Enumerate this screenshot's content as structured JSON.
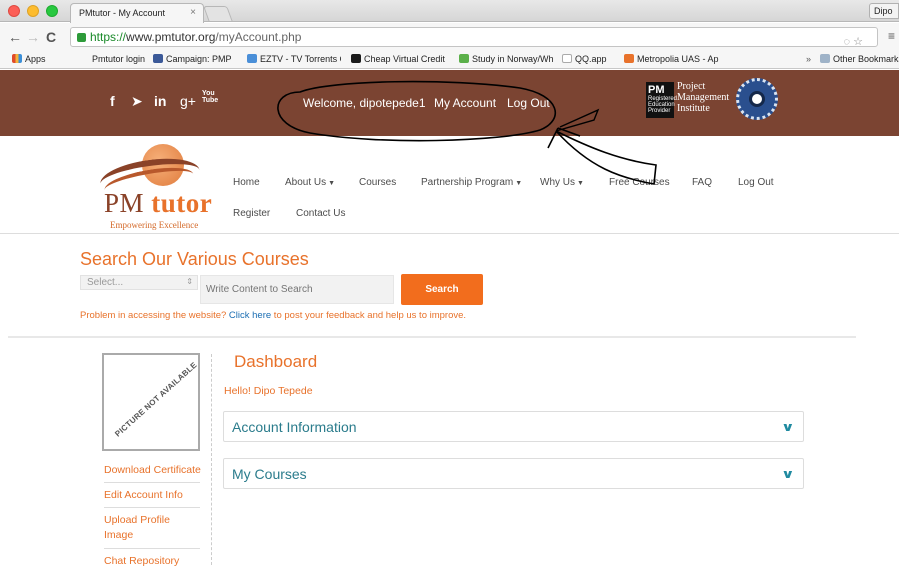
{
  "browser": {
    "tab_title": "PMtutor - My Account",
    "tab_close": "×",
    "profile": "Dipo",
    "url_scheme": "https://",
    "url_host": "www.pmtutor.org",
    "url_path": "/myAccount.php",
    "bookmarks": [
      {
        "label": "Apps",
        "color": "#e04b2a"
      },
      {
        "label": "Pmtutor login",
        "color": ""
      },
      {
        "label": "Campaign: PMP",
        "color": "#3b5998"
      },
      {
        "label": "EZTV - TV Torrents Online",
        "color": "#4a8fd8"
      },
      {
        "label": "Cheap Virtual Credit",
        "color": "#1b1b1b"
      },
      {
        "label": "Study in Norway/What",
        "color": "#5bb04a"
      },
      {
        "label": "QQ.app",
        "color": "#cccccc"
      },
      {
        "label": "Metropolia UAS - Ap",
        "color": "#e8722b"
      },
      {
        "label": "Other Bookmarks",
        "color": "#9fb3c8"
      }
    ],
    "bookmarks_more": "»"
  },
  "banner": {
    "welcome": "Welcome, dipotepede1",
    "my_account": "My Account",
    "logout": "Log Out",
    "pmi_small": "Registered Education Provider",
    "pmi_lines": [
      "Project",
      "Management",
      "Institute"
    ],
    "social": [
      "f",
      "t",
      "in",
      "g+",
      "You Tube"
    ]
  },
  "site": {
    "logo_pm": "PM",
    "logo_tutor": "tutor",
    "logo_tagline": "Empowering Excellence",
    "menu": [
      {
        "label": "Home",
        "caret": ""
      },
      {
        "label": "About Us",
        "caret": "▼"
      },
      {
        "label": "Courses",
        "caret": ""
      },
      {
        "label": "Partnership Program",
        "caret": "▼"
      },
      {
        "label": "Why Us",
        "caret": "▼"
      },
      {
        "label": "Free Courses",
        "caret": ""
      },
      {
        "label": "FAQ",
        "caret": ""
      },
      {
        "label": "Log Out",
        "caret": ""
      },
      {
        "label": "Register",
        "caret": ""
      },
      {
        "label": "Contact Us",
        "caret": ""
      }
    ]
  },
  "search": {
    "title": "Search Our Various Courses",
    "select_value": "Select...",
    "input_placeholder": "Write Content to Search",
    "button": "Search",
    "problem_prefix": "Problem in accessing the website? ",
    "problem_link": "Click here",
    "problem_suffix": " to post your feedback and help us to improve."
  },
  "dashboard": {
    "picture_text": "PICTURE NOT AVAILABLE",
    "title": "Dashboard",
    "hello": "Hello! Dipo Tepede",
    "sidebar_links": [
      "Download Certificate",
      "Edit Account Info",
      "Upload Profile Image",
      "Chat Repository"
    ],
    "panels": [
      "Account Information",
      "My Courses"
    ]
  },
  "colors": {
    "banner": "#7b4432",
    "accent": "#e8722b",
    "panel_text": "#2b7c8c"
  }
}
